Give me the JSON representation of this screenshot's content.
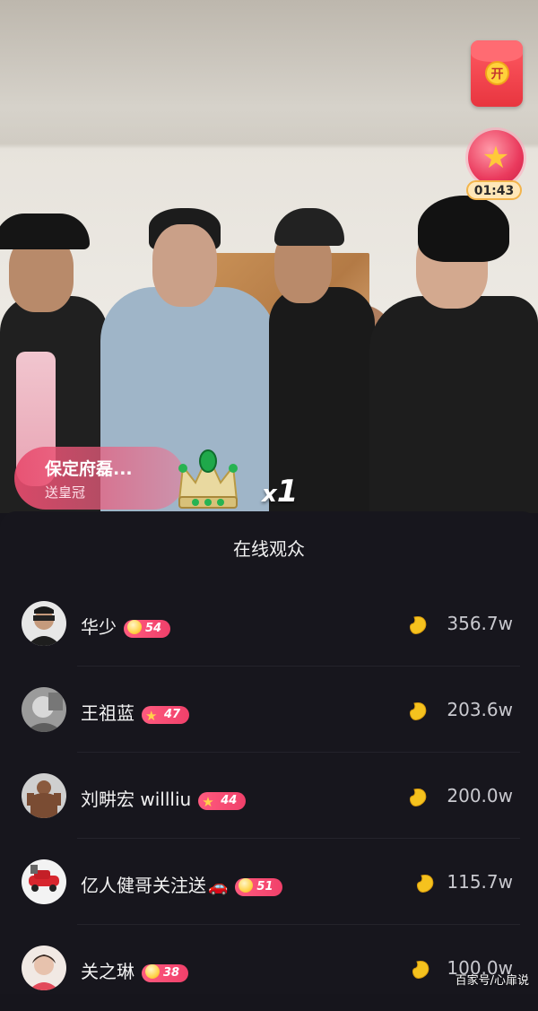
{
  "live": {
    "red_packet_glyph": "开",
    "timer": "01:43",
    "gift": {
      "sender": "保定府磊...",
      "action": "送皇冠",
      "combo_x": "x",
      "combo_count": "1"
    }
  },
  "panel": {
    "title": "在线观众"
  },
  "audience": [
    {
      "name": "华少",
      "level": "54",
      "level_icon": "ball-icon",
      "amount": "356.7w"
    },
    {
      "name": "王祖蓝",
      "level": "47",
      "level_icon": "star-icon",
      "amount": "203.6w"
    },
    {
      "name": "刘畊宏 willliu",
      "level": "44",
      "level_icon": "star-icon",
      "amount": "200.0w"
    },
    {
      "name": "亿人健哥关注送",
      "suffix": "🚗",
      "level": "51",
      "level_icon": "ball-icon",
      "amount": "115.7w"
    },
    {
      "name": "关之琳",
      "level": "38",
      "level_icon": "ball-icon",
      "amount": "100.0w"
    }
  ],
  "watermark": "百家号/心扉说",
  "colors": {
    "panel_bg": "#17161d",
    "level_badge": "#f0406a",
    "bean": "#f5c21e",
    "red_packet": "#e8353f"
  }
}
